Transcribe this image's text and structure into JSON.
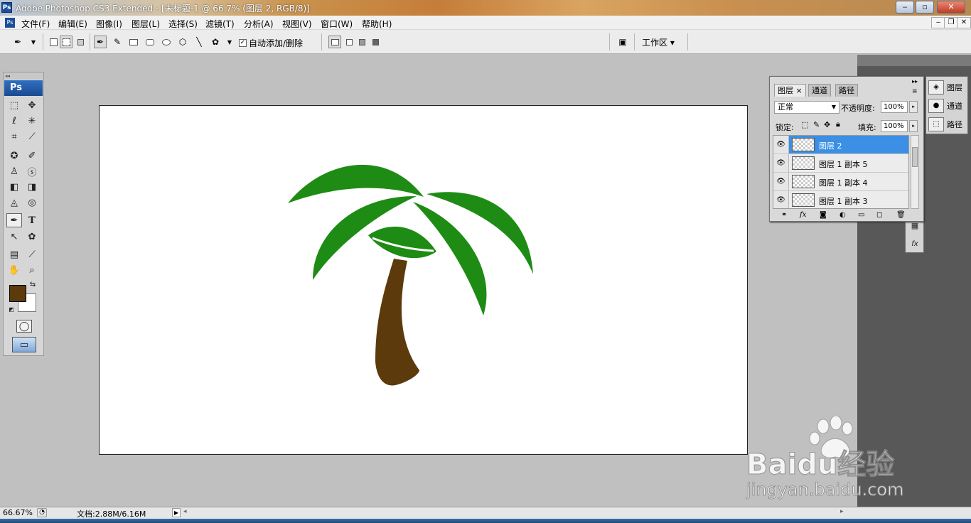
{
  "window": {
    "title": "Adobe Photoshop CS3 Extended - [未标题-1 @ 66.7% (图层 2, RGB/8)]",
    "app_badge": "Ps",
    "controls": [
      "‒",
      "▫",
      "✕"
    ],
    "doc_controls": [
      "‒",
      "❐",
      "✕"
    ]
  },
  "menu": {
    "items": [
      "文件(F)",
      "编辑(E)",
      "图像(I)",
      "图层(L)",
      "选择(S)",
      "滤镜(T)",
      "分析(A)",
      "视图(V)",
      "窗口(W)",
      "帮助(H)"
    ]
  },
  "options_bar": {
    "auto_add_delete_label": "自动添加/删除",
    "auto_add_delete_checked": true,
    "workspace_label": "工作区 ▾"
  },
  "toolbox": {
    "badge": "Ps",
    "foreground_color": "#5c3a0c",
    "background_color": "#ffffff"
  },
  "canvas": {
    "colors": {
      "leaf": "#1e8c14",
      "trunk": "#5c3a0c"
    }
  },
  "layers_panel": {
    "tabs": [
      "图层",
      "通道",
      "路径"
    ],
    "blend_mode": "正常",
    "opacity_label": "不透明度:",
    "opacity_value": "100%",
    "lock_label": "锁定:",
    "fill_label": "填充:",
    "fill_value": "100%",
    "layers": [
      {
        "name": "图层 2",
        "visible": true,
        "selected": true
      },
      {
        "name": "图层 1 副本 5",
        "visible": true,
        "selected": false
      },
      {
        "name": "图层 1 副本 4",
        "visible": true,
        "selected": false
      },
      {
        "name": "图层 1 副本 3",
        "visible": true,
        "selected": false
      }
    ]
  },
  "collapsed_panels": [
    {
      "label": "图层",
      "icon": "layers-icon"
    },
    {
      "label": "通道",
      "icon": "channels-icon"
    },
    {
      "label": "路径",
      "icon": "paths-icon"
    }
  ],
  "status_bar": {
    "zoom": "66.67%",
    "doc_size": "文档:2.88M/6.16M"
  },
  "watermark": {
    "brand": "Baidu经验",
    "url": "jingyan.baidu.com"
  }
}
